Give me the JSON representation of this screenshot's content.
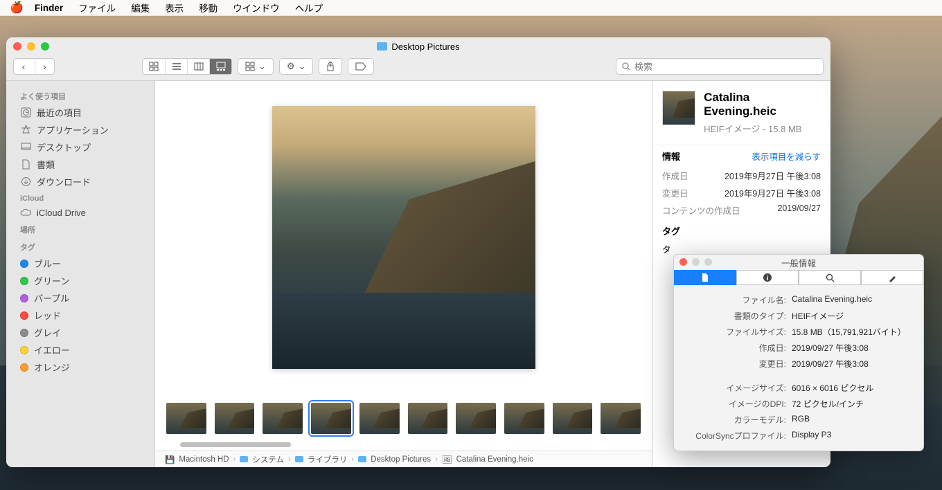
{
  "menubar": {
    "app": "Finder",
    "items": [
      "ファイル",
      "編集",
      "表示",
      "移動",
      "ウインドウ",
      "ヘルプ"
    ]
  },
  "window": {
    "title": "Desktop Pictures"
  },
  "search": {
    "placeholder": "検索"
  },
  "sidebar": {
    "favorites_header": "よく使う項目",
    "favorites": [
      {
        "label": "最近の項目",
        "icon": "clock"
      },
      {
        "label": "アプリケーション",
        "icon": "apps"
      },
      {
        "label": "デスクトップ",
        "icon": "desktop"
      },
      {
        "label": "書類",
        "icon": "doc"
      },
      {
        "label": "ダウンロード",
        "icon": "download"
      }
    ],
    "icloud_header": "iCloud",
    "icloud": [
      {
        "label": "iCloud Drive",
        "icon": "cloud"
      }
    ],
    "locations_header": "場所",
    "tags_header": "タグ",
    "tags": [
      {
        "label": "ブルー",
        "color": "#1b87f3"
      },
      {
        "label": "グリーン",
        "color": "#2fc84d"
      },
      {
        "label": "パープル",
        "color": "#b15ee6"
      },
      {
        "label": "レッド",
        "color": "#ff4b3e"
      },
      {
        "label": "グレイ",
        "color": "#8c8c8c"
      },
      {
        "label": "イエロー",
        "color": "#ffd230"
      },
      {
        "label": "オレンジ",
        "color": "#ff9a2d"
      }
    ]
  },
  "path": [
    "Macintosh HD",
    "システム",
    "ライブラリ",
    "Desktop Pictures",
    "Catalina Evening.heic"
  ],
  "info": {
    "filename": "Catalina Evening.heic",
    "subtitle": "HEIFイメージ - 15.8 MB",
    "section_info": "情報",
    "show_less": "表示項目を減らす",
    "created_k": "作成日",
    "created_v": "2019年9月27日 午後3:08",
    "modified_k": "変更日",
    "modified_v": "2019年9月27日 午後3:08",
    "content_created_k": "コンテンツの作成日",
    "content_created_v": "2019/09/27",
    "tag_header": "タグ",
    "tag_placeholder": "タ"
  },
  "inspector": {
    "title": "一般情報",
    "rows1": [
      {
        "k": "ファイル名:",
        "v": "Catalina Evening.heic"
      },
      {
        "k": "書類のタイプ:",
        "v": "HEIFイメージ"
      },
      {
        "k": "ファイルサイズ:",
        "v": "15.8 MB（15,791,921バイト）"
      },
      {
        "k": "作成日:",
        "v": "2019/09/27 午後3:08"
      },
      {
        "k": "変更日:",
        "v": "2019/09/27 午後3:08"
      }
    ],
    "rows2": [
      {
        "k": "イメージサイズ:",
        "v": "6016 × 6016 ピクセル"
      },
      {
        "k": "イメージのDPI:",
        "v": "72 ピクセル/インチ"
      },
      {
        "k": "カラーモデル:",
        "v": "RGB"
      },
      {
        "k": "ColorSyncプロファイル:",
        "v": "Display P3"
      }
    ]
  }
}
